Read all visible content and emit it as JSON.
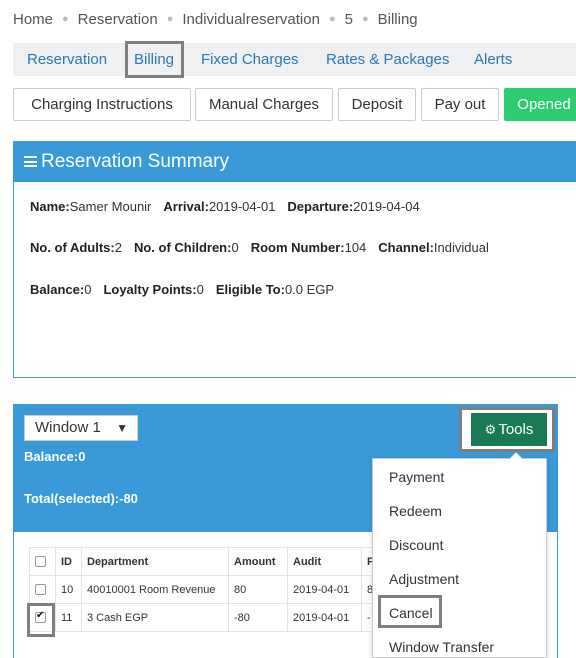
{
  "breadcrumb": [
    "Home",
    "Reservation",
    "Individualreservation",
    "5",
    "Billing"
  ],
  "tabs": [
    "Reservation",
    "Billing",
    "Fixed Charges",
    "Rates & Packages",
    "Alerts"
  ],
  "actions": {
    "charging": "Charging Instructions",
    "manual": "Manual Charges",
    "deposit": "Deposit",
    "payout": "Pay out",
    "opened": "Opened"
  },
  "summary": {
    "title": "Reservation Summary",
    "name_label": "Name:",
    "name": "Samer Mounir",
    "arrival_label": "Arrival:",
    "arrival": "2019-04-01",
    "departure_label": "Departure:",
    "departure": "2019-04-04",
    "adults_label": "No. of Adults:",
    "adults": "2",
    "children_label": "No. of Children:",
    "children": "0",
    "room_label": "Room Number:",
    "room": "104",
    "channel_label": "Channel:",
    "channel": "Individual",
    "balance_label": "Balance:",
    "balance": "0",
    "loyalty_label": "Loyalty Points:",
    "loyalty": "0",
    "eligible_label": "Eligible To:",
    "eligible": "0.0 EGP"
  },
  "window": {
    "selected": "Window 1",
    "balance_label": "Balance:",
    "balance": "0",
    "total_label": "Total(selected):",
    "total": "-80",
    "tools": "Tools"
  },
  "table": {
    "headers": [
      "ID",
      "Department",
      "Amount",
      "Audit",
      "F"
    ],
    "rows": [
      {
        "checked": false,
        "id": "10",
        "department": "40010001 Room Revenue",
        "amount": "80",
        "audit": "2019-04-01",
        "f": "8"
      },
      {
        "checked": true,
        "id": "11",
        "department": "3 Cash EGP",
        "amount": "-80",
        "audit": "2019-04-01",
        "f": "-"
      }
    ]
  },
  "tools_menu": [
    "Payment",
    "Redeem",
    "Discount",
    "Adjustment",
    "Cancel",
    "Window Transfer"
  ],
  "colors": {
    "accent": "#3a9ad9",
    "opened": "#2ecc71",
    "tools": "#1a7a55",
    "link": "#2b78b4"
  }
}
